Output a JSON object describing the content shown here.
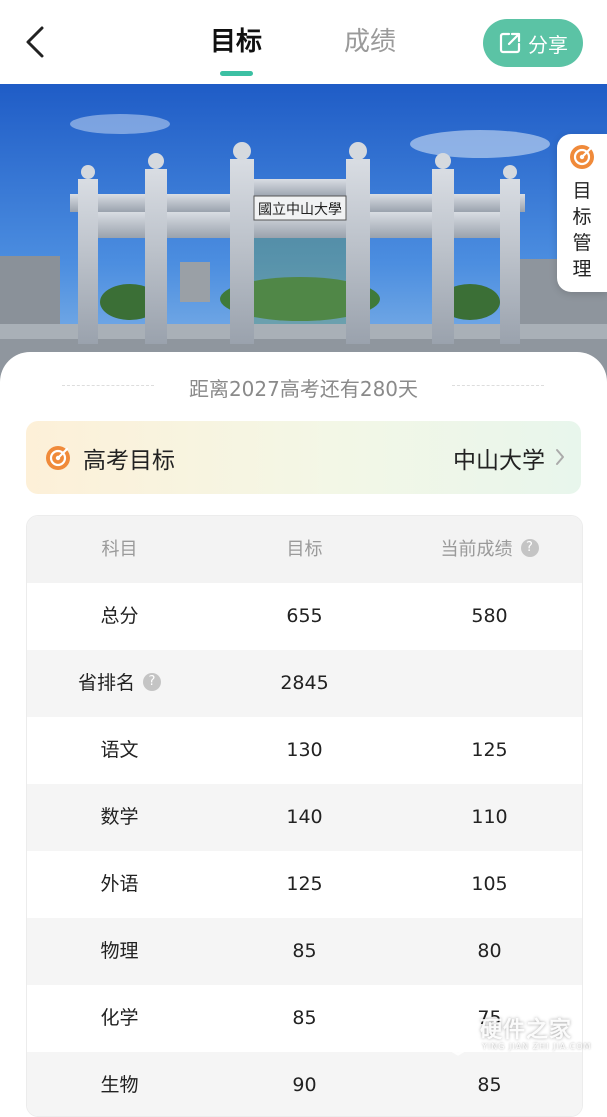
{
  "header": {
    "tabs": [
      {
        "label": "目标",
        "active": true
      },
      {
        "label": "成绩",
        "active": false
      }
    ],
    "share_label": "分享"
  },
  "side_tab": {
    "label": "目标管理"
  },
  "countdown": "距离2027高考还有280天",
  "goal": {
    "label": "高考目标",
    "value": "中山大学"
  },
  "table": {
    "headers": [
      "科目",
      "目标",
      "当前成绩"
    ],
    "rows": [
      {
        "subject": "总分",
        "target": "655",
        "current": "580"
      },
      {
        "subject": "省排名",
        "target": "2845",
        "current": ""
      },
      {
        "subject": "语文",
        "target": "130",
        "current": "125"
      },
      {
        "subject": "数学",
        "target": "140",
        "current": "110"
      },
      {
        "subject": "外语",
        "target": "125",
        "current": "105"
      },
      {
        "subject": "物理",
        "target": "85",
        "current": "80"
      },
      {
        "subject": "化学",
        "target": "85",
        "current": "75"
      },
      {
        "subject": "生物",
        "target": "90",
        "current": "85"
      }
    ]
  },
  "banner": {
    "gate_inscription": "國立中山大學"
  },
  "watermark": {
    "text": "硬件之家",
    "sub": "YING JIAN ZHI JIA.COM"
  },
  "colors": {
    "accent": "#5bc3a5",
    "goal_icon": "#f08a3a",
    "sky": "#2f6fd4"
  }
}
